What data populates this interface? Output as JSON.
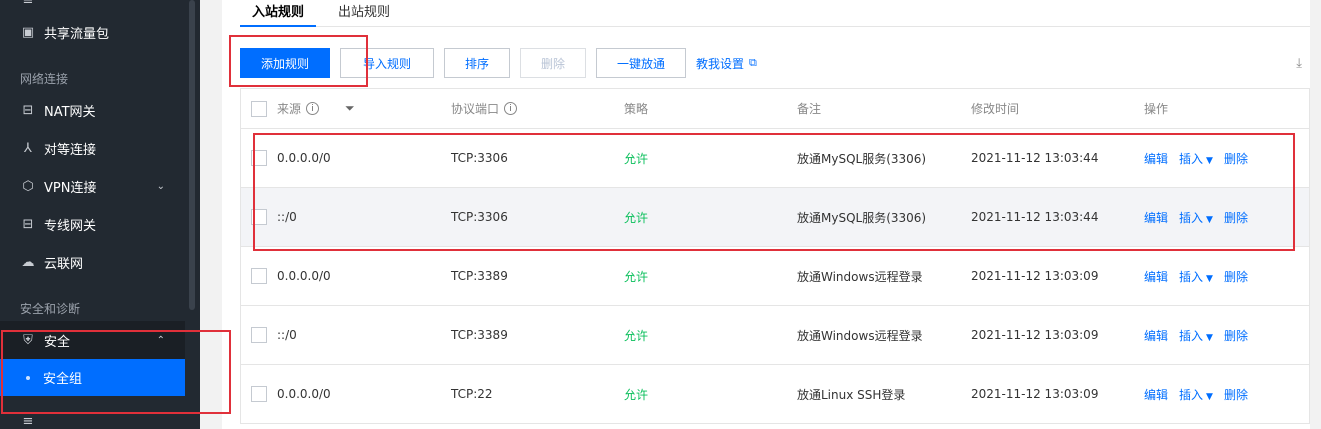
{
  "sidebar": {
    "items": [
      {
        "label": "共享流量包",
        "icon": "traffic-package-icon"
      },
      {
        "label": "NAT网关",
        "icon": "nat-gateway-icon"
      },
      {
        "label": "对等连接",
        "icon": "peering-icon"
      },
      {
        "label": "VPN连接",
        "icon": "vpn-icon"
      },
      {
        "label": "专线网关",
        "icon": "direct-connect-icon"
      },
      {
        "label": "云联网",
        "icon": "ccn-icon"
      },
      {
        "label": "安全",
        "icon": "shield-icon"
      }
    ],
    "groups": [
      "网络连接",
      "安全和诊断"
    ],
    "active_sub": "安全组"
  },
  "tabs": [
    "入站规则",
    "出站规则"
  ],
  "toolbar": {
    "add": "添加规则",
    "import": "导入规则",
    "sort": "排序",
    "delete": "删除",
    "open_all": "一键放通",
    "help": "教我设置"
  },
  "table": {
    "headers": [
      "来源",
      "协议端口",
      "策略",
      "备注",
      "修改时间",
      "操作"
    ],
    "rows": [
      {
        "source": "0.0.0.0/0",
        "port": "TCP:3306",
        "policy": "允许",
        "note": "放通MySQL服务(3306)",
        "time": "2021-11-12 13:03:44"
      },
      {
        "source": "::/0",
        "port": "TCP:3306",
        "policy": "允许",
        "note": "放通MySQL服务(3306)",
        "time": "2021-11-12 13:03:44"
      },
      {
        "source": "0.0.0.0/0",
        "port": "TCP:3389",
        "policy": "允许",
        "note": "放通Windows远程登录",
        "time": "2021-11-12 13:03:09"
      },
      {
        "source": "::/0",
        "port": "TCP:3389",
        "policy": "允许",
        "note": "放通Windows远程登录",
        "time": "2021-11-12 13:03:09"
      },
      {
        "source": "0.0.0.0/0",
        "port": "TCP:22",
        "policy": "允许",
        "note": "放通Linux SSH登录",
        "time": "2021-11-12 13:03:09"
      }
    ],
    "actions": {
      "edit": "编辑",
      "insert": "插入",
      "delete": "删除"
    }
  },
  "colors": {
    "accent": "#006eff",
    "allow": "#0abf5b",
    "annotation": "#e0303a",
    "sidebar": "#222931"
  }
}
